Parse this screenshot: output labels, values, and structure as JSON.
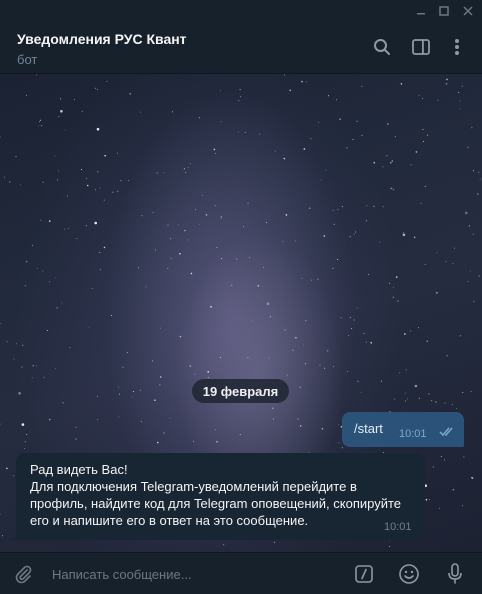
{
  "window": {
    "controls": [
      "minimize-icon",
      "maximize-icon",
      "close-icon"
    ]
  },
  "header": {
    "title": "Уведомления РУС Квант",
    "subtitle": "бот",
    "icons": [
      "search-icon",
      "sidebar-toggle-icon",
      "more-vertical-icon"
    ]
  },
  "chat": {
    "date_label": "19 февраля",
    "outgoing": {
      "text": "/start",
      "time": "10:01",
      "status": "read"
    },
    "incoming": {
      "lines": [
        "Рад видеть Вас!",
        "Для подключения Telegram-уведомлений перейдите в",
        "профиль, найдите код для Telegram оповещений, скопируйте",
        "его и напишите его в ответ на это сообщение."
      ],
      "time": "10:01"
    }
  },
  "composer": {
    "placeholder": "Написать сообщение...",
    "value": "",
    "icons": [
      "attach-icon",
      "bot-commands-icon",
      "emoji-icon",
      "microphone-icon"
    ]
  },
  "colors": {
    "sidebar_bg": "#17212b",
    "outgoing_bubble": "#2b5278",
    "incoming_bubble": "#182533",
    "secondary_text": "#708499"
  }
}
